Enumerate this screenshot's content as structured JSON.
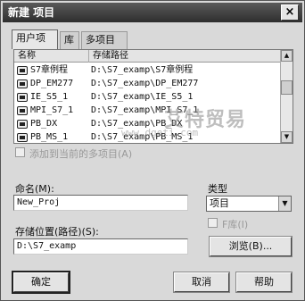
{
  "window": {
    "title": "新建 项目",
    "close_glyph": "×"
  },
  "tabs": [
    {
      "label": "用户项目"
    },
    {
      "label": "库"
    },
    {
      "label": "多项目"
    }
  ],
  "list": {
    "columns": [
      "名称",
      "存储路径"
    ],
    "rows": [
      {
        "name": "S7章例程",
        "path": "D:\\S7_examp\\S7章例程"
      },
      {
        "name": "DP_EM277",
        "path": "D:\\S7_examp\\DP_EM277"
      },
      {
        "name": "IE_S5_1",
        "path": "D:\\S7_examp\\IE_S5_1"
      },
      {
        "name": "MPI_S7_1",
        "path": "D:\\S7_examp\\MPI_S7_1"
      },
      {
        "name": "PB_DX",
        "path": "D:\\S7_examp\\PB_DX"
      },
      {
        "name": "PB_MS_1",
        "path": "D:\\S7_examp\\PB_MS_1"
      }
    ]
  },
  "add_multiproject_label": "添加到当前的多项目(A)",
  "name_label": "命名(M):",
  "name_value": "New_Proj",
  "type_label": "类型",
  "type_value": "项目",
  "library_label": "F库(I)",
  "location_label": "存储位置(路径)(S):",
  "location_value": "D:\\S7_examp",
  "browse_label": "浏览(B)...",
  "buttons": {
    "ok": "确定",
    "cancel": "取消",
    "help": "帮助"
  },
  "watermark": {
    "text": "艾特贸易",
    "url": "www.dgeti.com"
  }
}
